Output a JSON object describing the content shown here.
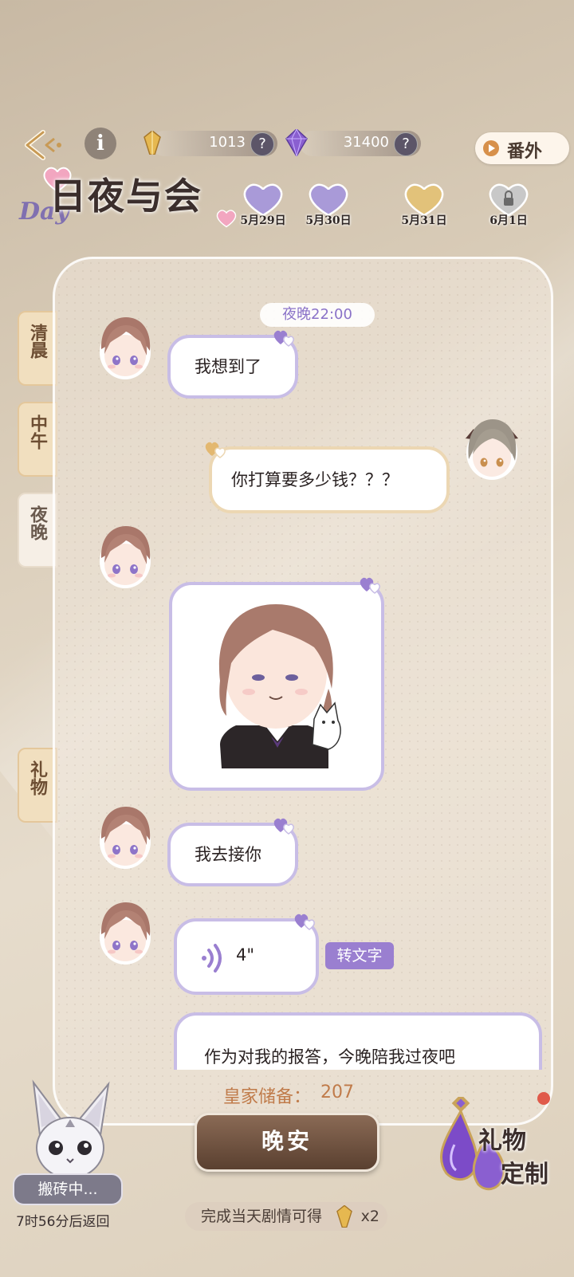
{
  "header": {
    "gold_count": "1013",
    "crystal_count": "31400",
    "help_mark": "?",
    "extra_label": "番外"
  },
  "logo": {
    "day": "Day",
    "title": "日夜与会"
  },
  "dates": [
    {
      "label": "5月29日",
      "color": "#a99ad8",
      "locked": false
    },
    {
      "label": "5月30日",
      "color": "#a99ad8",
      "locked": false
    },
    {
      "label": "5月31日",
      "color": "#e2c27a",
      "locked": false
    },
    {
      "label": "6月1日",
      "color": "#c8c8c8",
      "locked": true
    }
  ],
  "tabs": [
    {
      "label": "清晨",
      "active": false
    },
    {
      "label": "中午",
      "active": false
    },
    {
      "label": "夜晚",
      "active": true
    },
    {
      "label": "礼物",
      "active": false
    }
  ],
  "chat": {
    "time": "夜晚22:00",
    "messages": [
      {
        "from": "him",
        "type": "text",
        "text": "我想到了"
      },
      {
        "from": "me",
        "type": "text",
        "text": "你打算要多少钱？？？"
      },
      {
        "from": "him",
        "type": "sticker"
      },
      {
        "from": "him",
        "type": "text",
        "text": "我去接你"
      },
      {
        "from": "him",
        "type": "voice",
        "duration": "4\"",
        "to_text": "转文字"
      },
      {
        "from": "him",
        "type": "text",
        "text": "作为对我的报答，今晚陪我过夜吧"
      }
    ]
  },
  "bottom": {
    "reserve_label": "皇家储备：",
    "reserve_value": "207",
    "goodnight_button": "晚安",
    "complete_text": "完成当天剧情可得",
    "complete_reward": "x2",
    "working_label": "搬砖中...",
    "return_time": "7时56分后返回",
    "gift_line1": "礼物",
    "gift_line2": "定制"
  },
  "colors": {
    "accent_purple": "#9a7fd0",
    "bubble_border_purple": "#c8bde6",
    "bubble_border_gold": "#ecd7b3",
    "button_brown": "#6a4b38"
  }
}
